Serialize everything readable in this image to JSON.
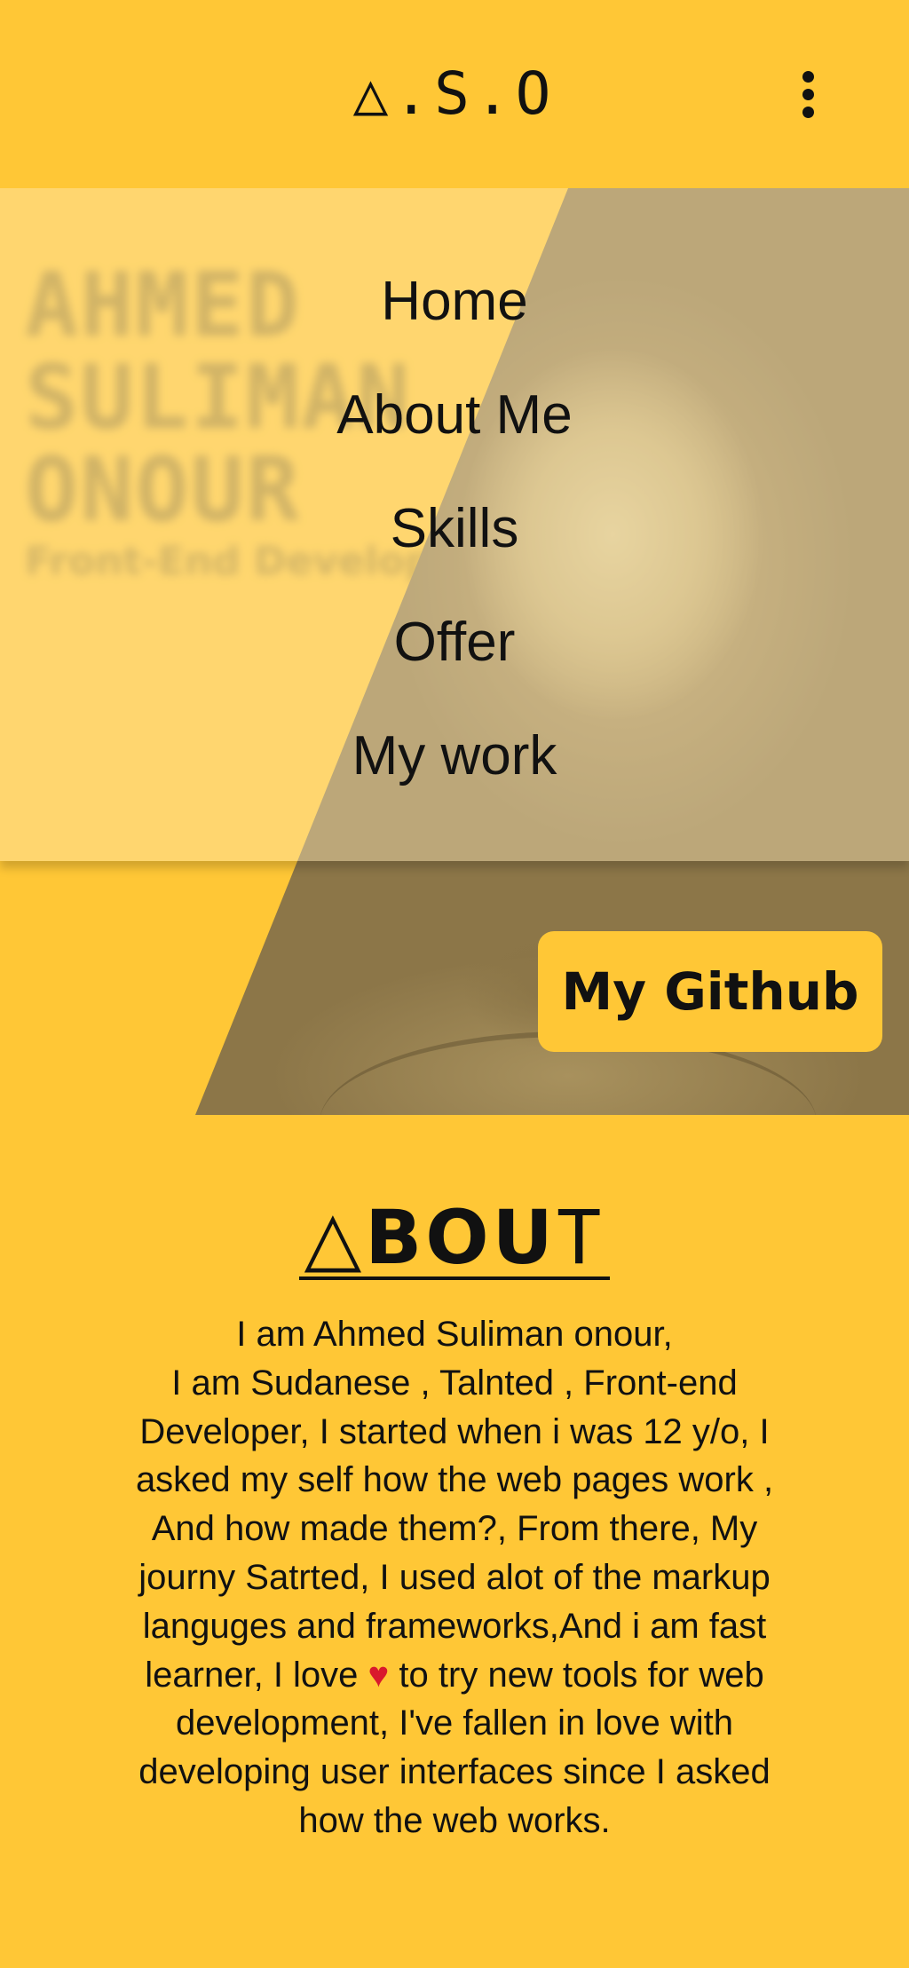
{
  "header": {
    "logo": "△.S.O",
    "menu_icon": "more-vertical-icon"
  },
  "hero": {
    "name_lines": [
      "AHMED",
      "SULIMAN",
      "ONOUR"
    ],
    "role": "Front-End Developer",
    "github_button": "My Github"
  },
  "nav": {
    "items": [
      {
        "label": "Home"
      },
      {
        "label": "About Me"
      },
      {
        "label": "Skills"
      },
      {
        "label": "Offer"
      },
      {
        "label": "My work"
      }
    ]
  },
  "about": {
    "title_tri": "△",
    "title_bold": "BOU",
    "title_thin": "T",
    "line1": "I am Ahmed Suliman onour,",
    "text_before_heart": "I am Sudanese , Talnted , Front-end Developer, I started when i was 12 y/o, I asked my self how the web pages work , And how made them?, From there, My journy Satrted, I used alot of the markup languges and frameworks,And i am fast learner, I love",
    "heart": "♥",
    "text_after_heart": "to try new tools for web development, I've fallen in love with developing user interfaces since I asked how the web works."
  },
  "colors": {
    "background": "#FFC736",
    "text": "#111111",
    "heart": "#D9192C"
  }
}
